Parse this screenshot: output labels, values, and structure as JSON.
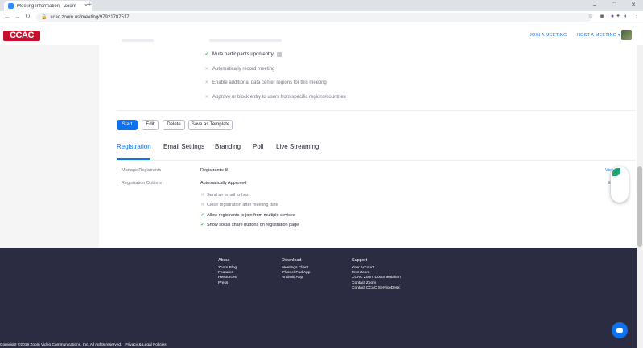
{
  "browser": {
    "tab_title": "Meeting Information - Zoom",
    "tab_close": "×",
    "new_tab": "+",
    "minimize": "–",
    "maximize": "☐",
    "close": "✕",
    "url": "ccac.zoom.us/meeting/97921787517",
    "back": "←",
    "forward": "→",
    "reload": "↻",
    "lock": "🔒",
    "ext_icons": [
      "☆",
      "▣",
      "●",
      "✦",
      "◐",
      "⋮"
    ]
  },
  "header": {
    "logo_text": "CCAC",
    "join_meeting": "JOIN A MEETING",
    "host_meeting": "HOST A MEETING ▾"
  },
  "options": [
    {
      "label": "Mute participants upon entry",
      "enabled": true,
      "info": "i"
    },
    {
      "label": "Automatically record meeting",
      "enabled": false
    },
    {
      "label": "Enable additional data center regions for this meeting",
      "enabled": false
    },
    {
      "label": "Approve or block entry to users from specific regions/countries",
      "enabled": false
    }
  ],
  "marks": {
    "check": "✔",
    "cross": "✕"
  },
  "actions": {
    "start": "Start",
    "edit": "Edit",
    "delete": "Delete",
    "save_template": "Save as Template"
  },
  "tabs": [
    "Registration",
    "Email Settings",
    "Branding",
    "Poll",
    "Live Streaming"
  ],
  "registration": {
    "manage_label": "Manage Registrants",
    "manage_value": "Registrants: 8",
    "view_link": "View",
    "options_label": "Registration Options",
    "options_value": "Automatically Approved",
    "edit_link": "Edit",
    "settings": [
      {
        "label": "Send an email to host",
        "enabled": false
      },
      {
        "label": "Close registration after meeting date",
        "enabled": false
      },
      {
        "label": "Allow registrants to join from multiple devices",
        "enabled": true
      },
      {
        "label": "Show social share buttons on registration page",
        "enabled": true
      }
    ]
  },
  "footer": {
    "about": {
      "heading": "About",
      "items": [
        "Zoom Blog",
        "Features",
        "Resources",
        "Press"
      ]
    },
    "download": {
      "heading": "Download",
      "items": [
        "Meetings Client",
        "iPhone/iPad App",
        "Android App"
      ]
    },
    "support": {
      "heading": "Support",
      "items": [
        "Your Account",
        "Test Zoom",
        "CCAC Zoom Documentation",
        "Contact Zoom",
        "Contact CCAC ServiceDesk"
      ]
    },
    "copyright": "Copyright ©2019 Zoom Video Communications, Inc. All rights reserved.",
    "policies": "Privacy & Legal Policies"
  },
  "colors": {
    "accent": "#0e72ed",
    "brand": "#c8102e",
    "footer_bg": "#2b2c41",
    "check": "#23d959"
  }
}
